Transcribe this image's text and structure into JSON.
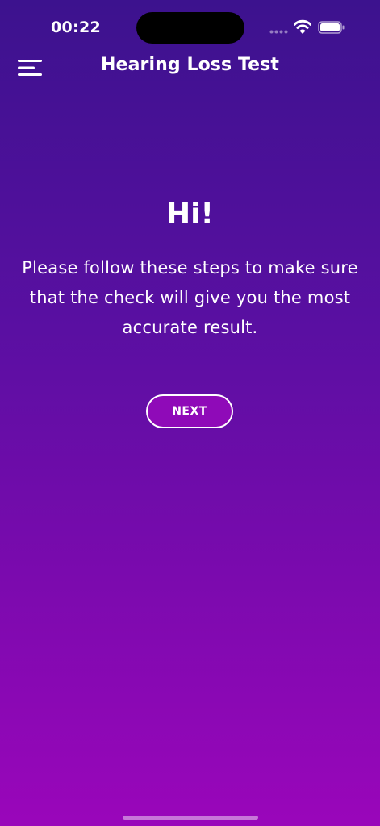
{
  "status_bar": {
    "time": "00:22",
    "icons": [
      "cellular-signal-icon",
      "wifi-icon",
      "battery-icon"
    ]
  },
  "nav": {
    "title": "Hearing Loss Test",
    "menu_icon": "hamburger-menu-icon"
  },
  "main": {
    "greeting": "Hi!",
    "intro": "Please follow these steps to make sure that the check will give you the most accurate result.",
    "next_label": "NEXT"
  },
  "colors": {
    "gradient_top": "#3c128e",
    "gradient_bottom": "#9a06ba",
    "button_fill": "#8f0ab8",
    "text": "#ffffff"
  }
}
